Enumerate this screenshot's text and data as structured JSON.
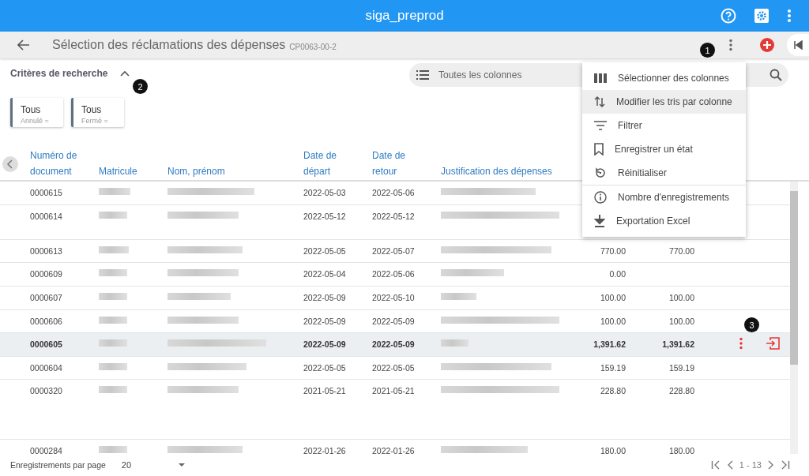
{
  "app_bar": {
    "title": "siga_preprod"
  },
  "page_header": {
    "title": "Sélection des réclamations des dépenses",
    "code": "CP0063-00-2"
  },
  "criteria": {
    "label": "Critères de recherche",
    "expanded": true
  },
  "filters": [
    {
      "value": "Tous",
      "label": "Annulé ="
    },
    {
      "value": "Tous",
      "label": "Fermé ="
    }
  ],
  "search": {
    "placeholder": "Toutes les colonnes"
  },
  "table": {
    "columns": [
      "Numéro de document",
      "Matricule",
      "Nom, prénom",
      "Date de départ",
      "Date de retour",
      "Justification des dépenses"
    ],
    "rows": [
      {
        "document": "0000615",
        "depart": "2022-05-03",
        "retour": "2022-05-06",
        "selected": false
      },
      {
        "document": "0000614",
        "depart": "2022-05-12",
        "retour": "2022-05-12",
        "selected": false
      },
      {
        "document": "0000613",
        "depart": "2022-05-05",
        "retour": "2022-05-07",
        "amount_1": "770.00",
        "amount_2": "770.00",
        "selected": false
      },
      {
        "document": "0000609",
        "depart": "2022-05-04",
        "retour": "2022-05-06",
        "amount_1": "0.00",
        "selected": false
      },
      {
        "document": "0000607",
        "depart": "2022-05-09",
        "retour": "2022-05-10",
        "amount_1": "100.00",
        "amount_2": "100.00",
        "selected": false
      },
      {
        "document": "0000606",
        "depart": "2022-05-09",
        "retour": "2022-05-09",
        "amount_1": "100.00",
        "amount_2": "100.00",
        "selected": false
      },
      {
        "document": "0000605",
        "depart": "2022-05-09",
        "retour": "2022-05-09",
        "amount_1": "1,391.62",
        "amount_2": "1,391.62",
        "selected": true
      },
      {
        "document": "0000604",
        "depart": "2022-05-05",
        "retour": "2022-05-05",
        "amount_1": "159.19",
        "amount_2": "159.19",
        "selected": false
      },
      {
        "document": "0000320",
        "depart": "2021-05-21",
        "retour": "2021-05-21",
        "amount_1": "228.80",
        "amount_2": "228.80",
        "selected": false
      },
      {
        "document": "0000284",
        "depart": "2022-01-26",
        "retour": "2022-01-26",
        "amount_1": "180.00",
        "amount_2": "180.00",
        "selected": false
      }
    ]
  },
  "menu": {
    "items": [
      {
        "label": "Sélectionner des colonnes",
        "kind": "columns",
        "selected": false
      },
      {
        "label": "Modifier les tris par colonne",
        "kind": "sort",
        "selected": true
      },
      {
        "label": "Filtrer",
        "kind": "filter",
        "selected": false
      },
      {
        "label": "Enregistrer un état",
        "kind": "bookmark",
        "selected": false
      },
      {
        "label": "Réinitialiser",
        "kind": "reset",
        "selected": false
      },
      {
        "label": "Nombre d'enregistrements",
        "kind": "info",
        "selected": false
      },
      {
        "label": "Exportation Excel",
        "kind": "download",
        "selected": false
      }
    ]
  },
  "markers": [
    "1",
    "2",
    "3"
  ],
  "footer": {
    "per_page_label": "Enregistrements par page",
    "per_page": "20",
    "range": "1 - 13"
  }
}
